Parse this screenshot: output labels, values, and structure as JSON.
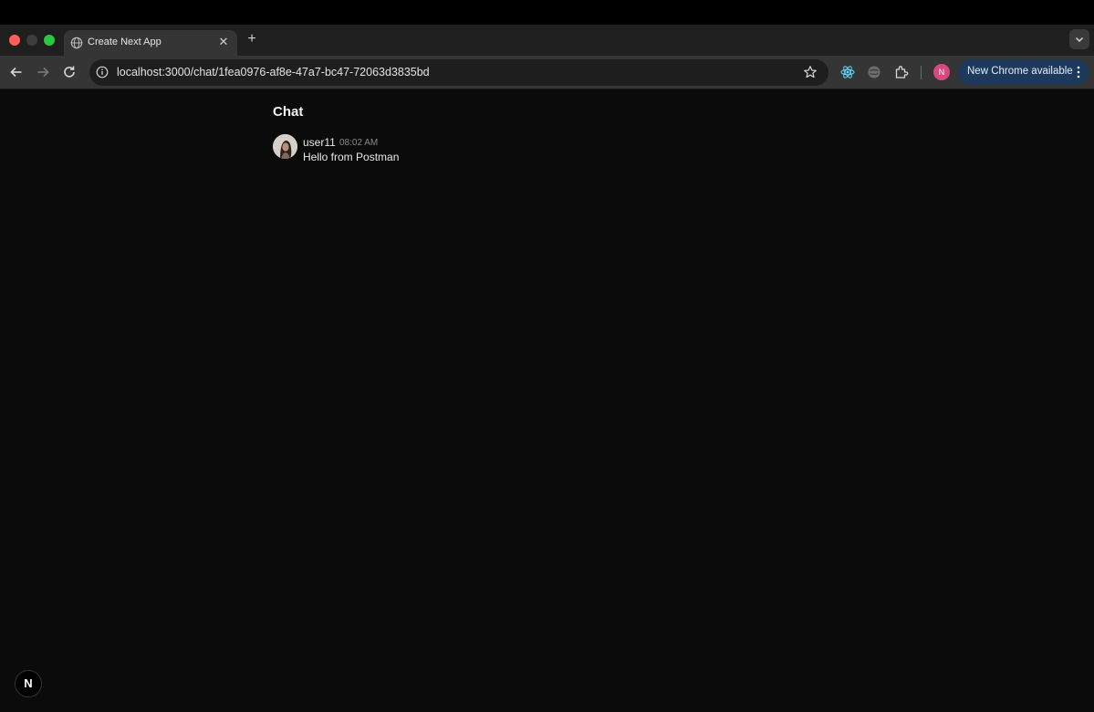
{
  "browser": {
    "tab": {
      "title": "Create Next App",
      "close_glyph": "✕",
      "favicon": "globe-icon"
    },
    "new_tab_glyph": "+",
    "url": "localhost:3000/chat/1fea0976-af8e-47a7-bc47-72063d3835bd",
    "profile_initial": "N",
    "update_label": "New Chrome available",
    "colors": {
      "profile": "#d9487d",
      "update_pill": "#1d3a5c"
    }
  },
  "page": {
    "title": "Chat",
    "messages": [
      {
        "user": "user11",
        "time": "08:02 AM",
        "text": "Hello from Postman"
      }
    ],
    "next_badge": "N"
  }
}
